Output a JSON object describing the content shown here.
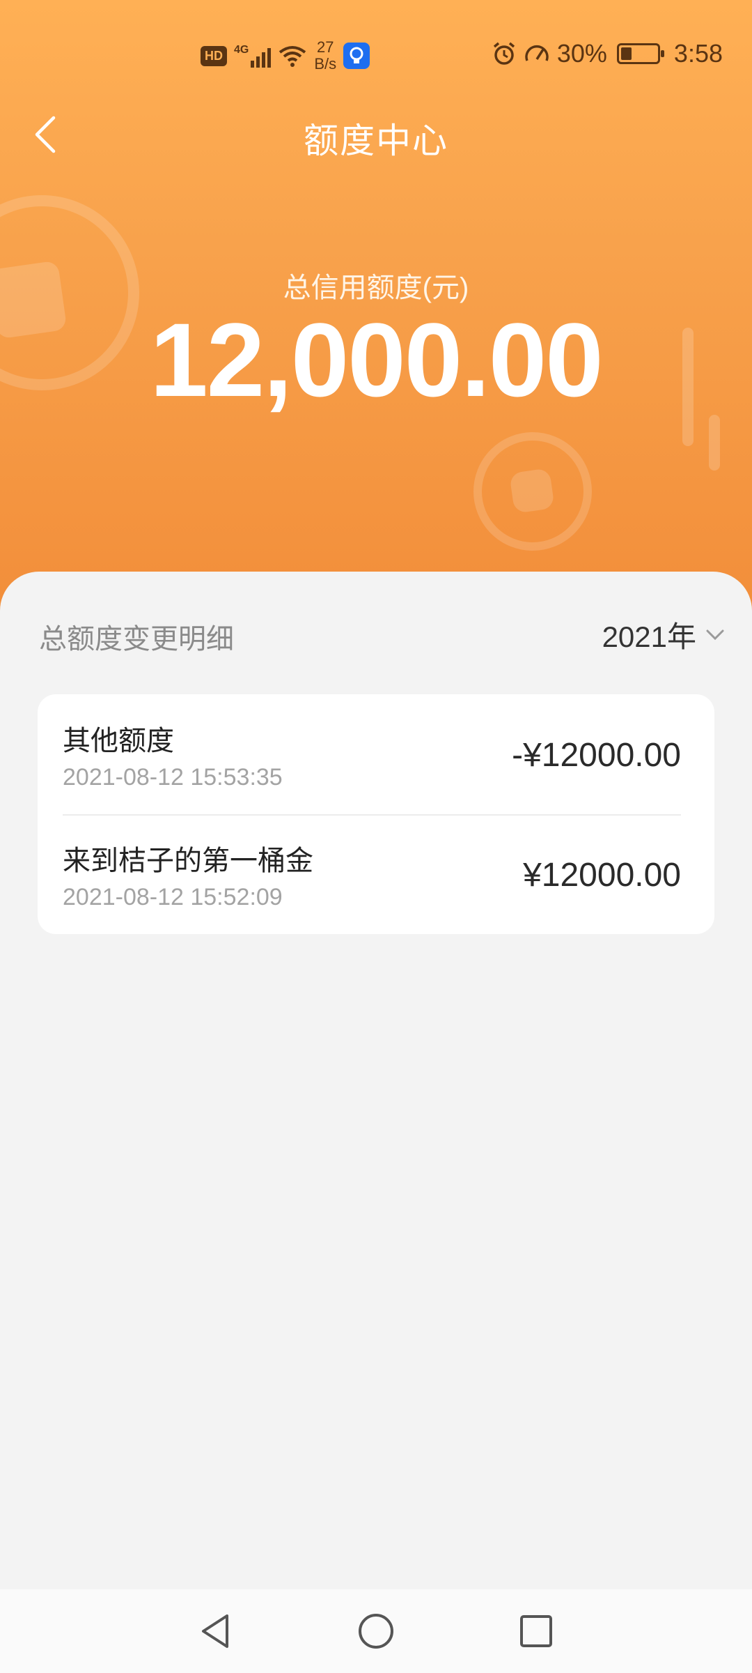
{
  "status_bar": {
    "network_badge": "HD",
    "signal_type": "4G",
    "net_speed_value": "27",
    "net_speed_unit": "B/s",
    "battery_percent": "30%",
    "time": "3:58",
    "battery_level": 0.3
  },
  "header": {
    "title": "额度中心",
    "back_icon": "chevron-left-icon"
  },
  "credit": {
    "label": "总信用额度(元)",
    "amount": "12,000.00"
  },
  "section": {
    "title": "总额度变更明细",
    "year_label": "2021年"
  },
  "records": [
    {
      "name": "其他额度",
      "time": "2021-08-12 15:53:35",
      "amount": "-¥12000.00"
    },
    {
      "name": "来到桔子的第一桶金",
      "time": "2021-08-12 15:52:09",
      "amount": "¥12000.00"
    }
  ],
  "colors": {
    "hero_top": "#ffb055",
    "hero_bottom": "#f28e3a",
    "background": "#f3f3f3"
  }
}
